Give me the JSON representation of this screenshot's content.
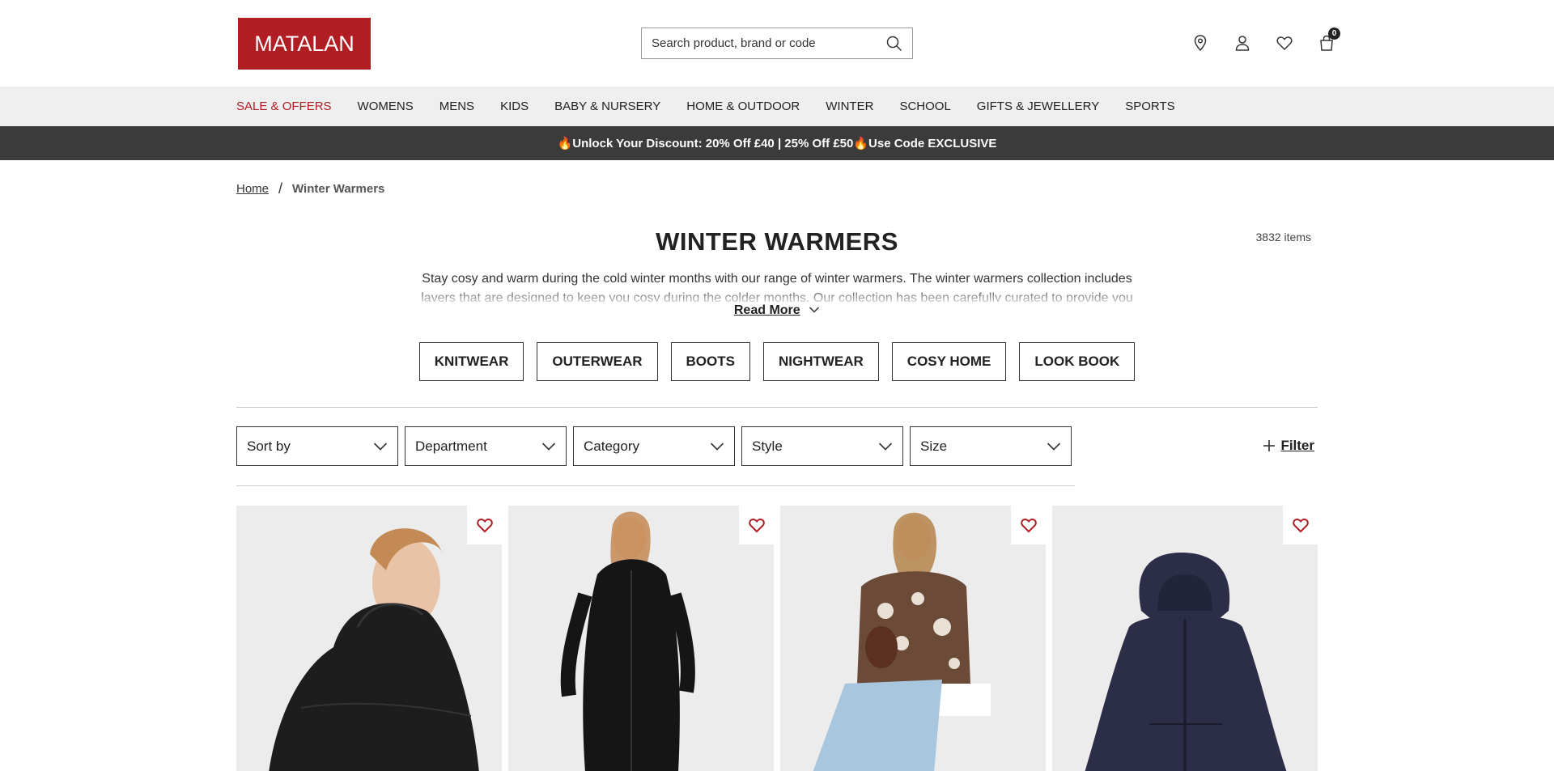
{
  "header": {
    "logo_text": "MATALAN",
    "search_placeholder": "Search product, brand or code",
    "basket_count": "0"
  },
  "nav": {
    "items": [
      "SALE & OFFERS",
      "WOMENS",
      "MENS",
      "KIDS",
      "BABY & NURSERY",
      "HOME & OUTDOOR",
      "WINTER",
      "SCHOOL",
      "GIFTS & JEWELLERY",
      "SPORTS"
    ]
  },
  "promo": {
    "text": "🔥Unlock Your Discount: 20% Off £40 | 25% Off £50🔥Use Code EXCLUSIVE"
  },
  "breadcrumb": {
    "home": "Home",
    "separator": "/",
    "current": "Winter Warmers"
  },
  "page": {
    "title": "WINTER WARMERS",
    "item_count": "3832 items",
    "description": "Stay cosy and warm during the cold winter months with our range of winter warmers. The winter warmers collection includes layers that are designed to keep you cosy during the colder months. Our collection has been carefully curated to provide you",
    "read_more": "Read More"
  },
  "categories": [
    "KNITWEAR",
    "OUTERWEAR",
    "BOOTS",
    "NIGHTWEAR",
    "COSY HOME",
    "LOOK BOOK"
  ],
  "filters": {
    "sort_by": "Sort by",
    "department": "Department",
    "category": "Category",
    "style": "Style",
    "size": "Size",
    "filter": "Filter"
  },
  "colors": {
    "brand": "#b01e23",
    "promo_bg": "#3b3b3b",
    "nav_bg": "#efefef"
  },
  "products": [
    {
      "image": "woman-black-puffer-coat-profile"
    },
    {
      "image": "woman-black-long-puffer-coat"
    },
    {
      "image": "woman-animal-print-jumper-jeans"
    },
    {
      "image": "navy-zip-hoodie"
    }
  ]
}
